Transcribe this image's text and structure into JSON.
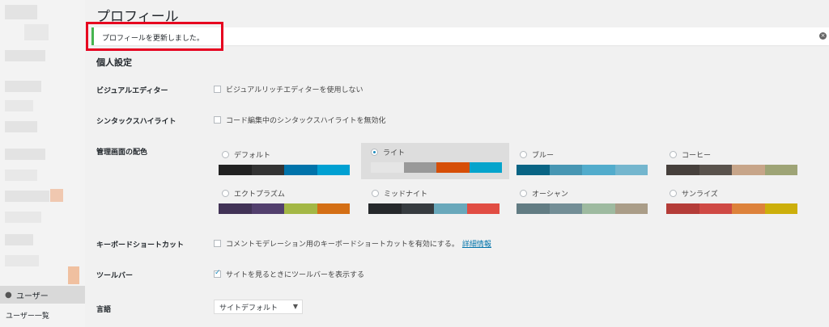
{
  "page": {
    "title": "プロフィール"
  },
  "notice": {
    "text": "プロフィールを更新しました。",
    "dismiss_glyph": "×"
  },
  "sidebar": {
    "active_menu": "ユーザー",
    "submenu_first": "ユーザー一覧",
    "user_icon": "user-icon"
  },
  "section": {
    "title": "個人設定"
  },
  "rows": {
    "visual_editor": {
      "label": "ビジュアルエディター",
      "option": "ビジュアルリッチエディターを使用しない",
      "checked": false
    },
    "syntax": {
      "label": "シンタックスハイライト",
      "option": "コード編集中のシンタックスハイライトを無効化",
      "checked": false
    },
    "color_scheme": {
      "label": "管理画面の配色"
    },
    "keyboard": {
      "label": "キーボードショートカット",
      "option": "コメントモデレーション用のキーボードショートカットを有効にする。",
      "link": "詳細情報",
      "checked": false
    },
    "toolbar": {
      "label": "ツールバー",
      "option": "サイトを見るときにツールバーを表示する",
      "checked": true
    },
    "language": {
      "label": "言語",
      "value": "サイトデフォルト"
    }
  },
  "schemes": [
    {
      "name": "デフォルト",
      "selected": false,
      "colors": [
        "#222222",
        "#333333",
        "#0073aa",
        "#00a0d2"
      ]
    },
    {
      "name": "ライト",
      "selected": true,
      "colors": [
        "#e5e5e5",
        "#999999",
        "#d64e07",
        "#04a4cc"
      ]
    },
    {
      "name": "ブルー",
      "selected": false,
      "colors": [
        "#096484",
        "#4796b3",
        "#52accc",
        "#74b6ce"
      ]
    },
    {
      "name": "コーヒー",
      "selected": false,
      "colors": [
        "#46403c",
        "#59524c",
        "#c7a589",
        "#9ea476"
      ]
    },
    {
      "name": "エクトプラズム",
      "selected": false,
      "colors": [
        "#413256",
        "#523f6d",
        "#a3b745",
        "#d46f15"
      ]
    },
    {
      "name": "ミッドナイト",
      "selected": false,
      "colors": [
        "#25282b",
        "#363b3f",
        "#69a8bb",
        "#e14d43"
      ]
    },
    {
      "name": "オーシャン",
      "selected": false,
      "colors": [
        "#627c83",
        "#738e96",
        "#9ebaa0",
        "#aa9d88"
      ]
    },
    {
      "name": "サンライズ",
      "selected": false,
      "colors": [
        "#b43c38",
        "#cf4944",
        "#dd823b",
        "#ccaf0b"
      ]
    }
  ]
}
